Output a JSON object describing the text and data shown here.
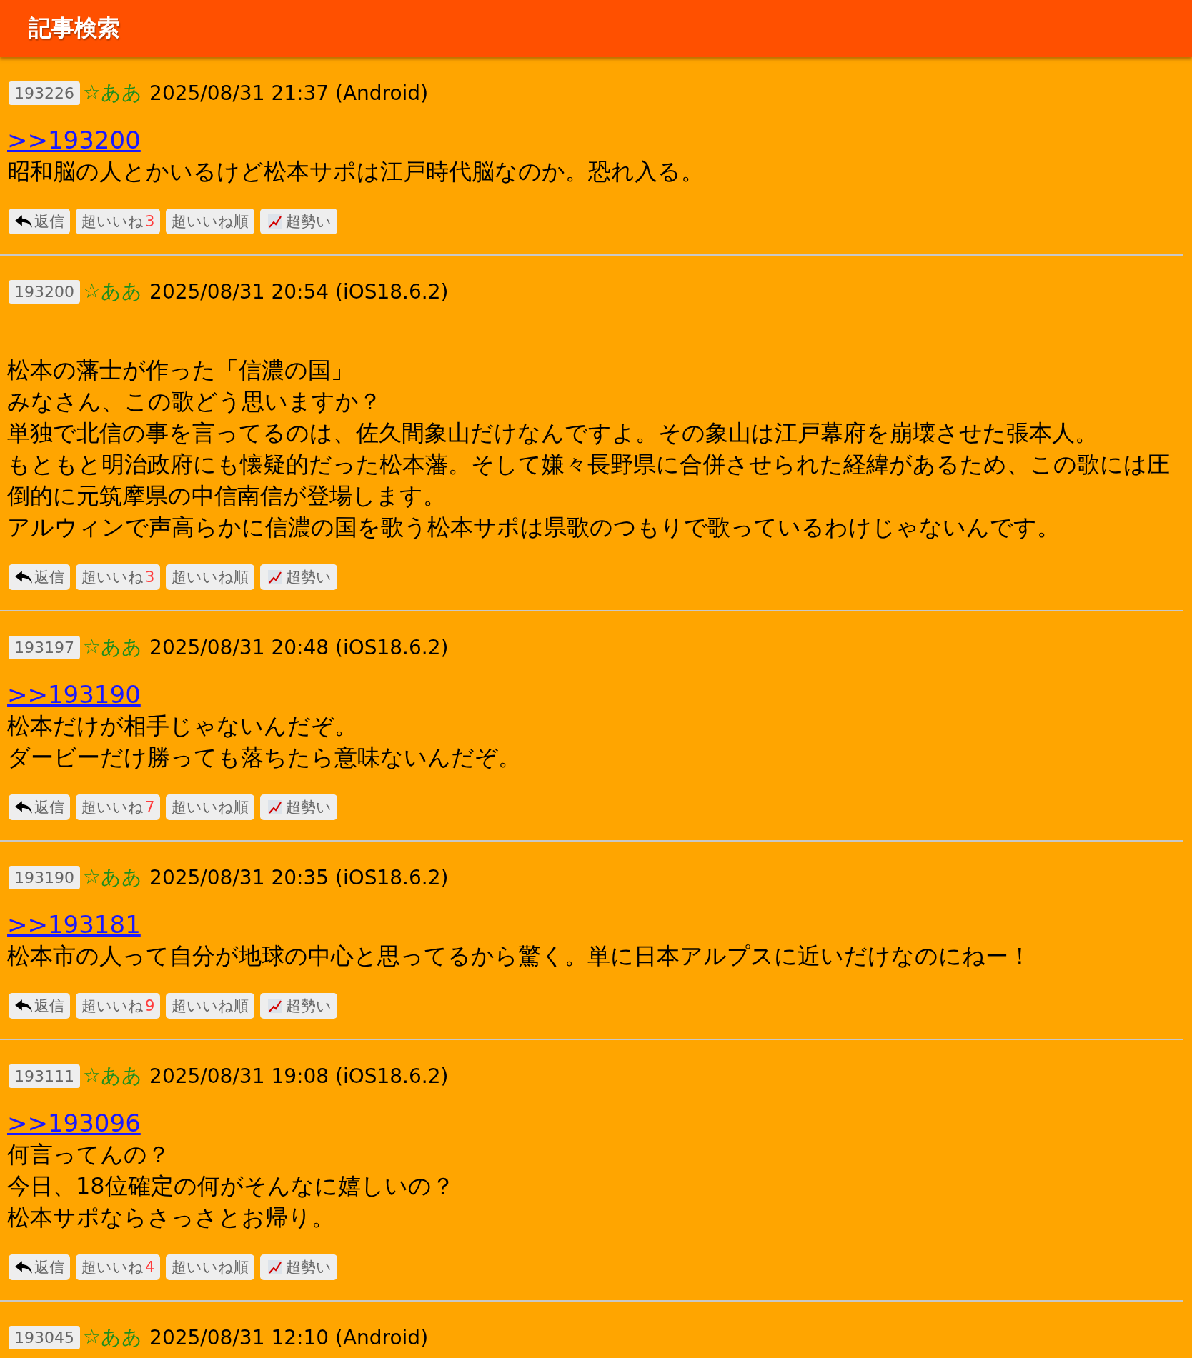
{
  "header": {
    "title": "記事検索"
  },
  "posts": [
    {
      "id": "193226",
      "name": "☆ああ",
      "datetime": "2025/08/31 21:37 (Android)",
      "reply_to": ">>193200",
      "lines": [
        "昭和脳の人とかいるけど松本サポは江戸時代脳なのか。恐れ入る。"
      ],
      "actions": [
        {
          "kind": "reply",
          "label": "返信"
        },
        {
          "kind": "like",
          "label": "超いいね",
          "count": "3"
        },
        {
          "kind": "sort",
          "label": "超いいね順"
        },
        {
          "kind": "trend",
          "label": "超勢い"
        }
      ]
    },
    {
      "id": "193200",
      "name": "☆ああ",
      "datetime": "2025/08/31 20:54 (iOS18.6.2)",
      "lines": [
        "松本の藩士が作った「信濃の国」",
        "みなさん、この歌どう思いますか？",
        "単独で北信の事を言ってるのは、佐久間象山だけなんですよ。その象山は江戸幕府を崩壊させた張本人。",
        "もともと明治政府にも懐疑的だった松本藩。そして嫌々長野県に合併させられた経緯があるため、この歌には圧倒的に元筑摩県の中信南信が登場します。",
        "アルウィンで声高らかに信濃の国を歌う松本サポは県歌のつもりで歌っているわけじゃないんです。"
      ],
      "actions": [
        {
          "kind": "reply",
          "label": "返信"
        },
        {
          "kind": "like",
          "label": "超いいね",
          "count": "3"
        },
        {
          "kind": "sort",
          "label": "超いいね順"
        },
        {
          "kind": "trend",
          "label": "超勢い"
        }
      ]
    },
    {
      "id": "193197",
      "name": "☆ああ",
      "datetime": "2025/08/31 20:48 (iOS18.6.2)",
      "reply_to": ">>193190",
      "lines": [
        "松本だけが相手じゃないんだぞ。",
        "ダービーだけ勝っても落ちたら意味ないんだぞ。"
      ],
      "actions": [
        {
          "kind": "reply",
          "label": "返信"
        },
        {
          "kind": "like",
          "label": "超いいね",
          "count": "7"
        },
        {
          "kind": "sort",
          "label": "超いいね順"
        },
        {
          "kind": "trend",
          "label": "超勢い"
        }
      ]
    },
    {
      "id": "193190",
      "name": "☆ああ",
      "datetime": "2025/08/31 20:35 (iOS18.6.2)",
      "reply_to": ">>193181",
      "lines": [
        "松本市の人って自分が地球の中心と思ってるから驚く。単に日本アルプスに近いだけなのにねー！"
      ],
      "actions": [
        {
          "kind": "reply",
          "label": "返信"
        },
        {
          "kind": "like",
          "label": "超いいね",
          "count": "9"
        },
        {
          "kind": "sort",
          "label": "超いいね順"
        },
        {
          "kind": "trend",
          "label": "超勢い"
        }
      ]
    },
    {
      "id": "193111",
      "name": "☆ああ",
      "datetime": "2025/08/31 19:08 (iOS18.6.2)",
      "reply_to": ">>193096",
      "lines": [
        "何言ってんの？",
        "今日、18位確定の何がそんなに嬉しいの？",
        "松本サポならさっさとお帰り。"
      ],
      "actions": [
        {
          "kind": "reply",
          "label": "返信"
        },
        {
          "kind": "like",
          "label": "超いいね",
          "count": "4"
        },
        {
          "kind": "sort",
          "label": "超いいね順"
        },
        {
          "kind": "trend",
          "label": "超勢い"
        }
      ]
    },
    {
      "id": "193045",
      "name": "☆ああ",
      "datetime": "2025/08/31 12:10 (Android)"
    }
  ]
}
